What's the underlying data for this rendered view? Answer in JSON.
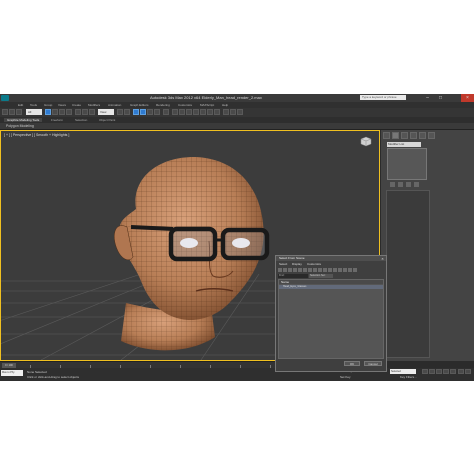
{
  "window": {
    "title": "Autodesk 3ds Max 2012 x64    Elderly_Man_head_render_2.max",
    "search_placeholder": "Type a keyword or phrase"
  },
  "menu": [
    "Edit",
    "Tools",
    "Group",
    "Views",
    "Create",
    "Modifiers",
    "Animation",
    "Graph Editors",
    "Rendering",
    "Customize",
    "MAXScript",
    "Help"
  ],
  "toolbar": {
    "selection_filter": "All",
    "view_dropdown": "View"
  },
  "ribbon": {
    "tabs": [
      "Graphite Modeling Tools",
      "Freeform",
      "Selection",
      "Object Paint"
    ],
    "panel_label": "Polygon Modeling"
  },
  "viewport": {
    "label": "[ + ] [ Perspective ] [ Smooth + Highlights ]"
  },
  "command_panel": {
    "modifier_list": "Modifier List"
  },
  "dialog": {
    "title": "Select From Scene",
    "menu": [
      "Select",
      "Display",
      "Customize"
    ],
    "find_placeholder": "Find:",
    "selection_set": "Selection Set:",
    "column_header": "Name",
    "row_label": "Head_Eyes_Glasses",
    "ok_label": "OK",
    "cancel_label": "Cancel"
  },
  "timeline": {
    "frame": "0 / 100"
  },
  "status": {
    "maxscript_label": "Max to Phy",
    "line1": "None Selected",
    "line2": "Click or click-and-drag to select objects",
    "auto_key": "Auto Key",
    "key_mode": "Selected",
    "set_key": "Set Key",
    "key_filters": "Key Filters..."
  },
  "colors": {
    "viewport_border": "#f0c020",
    "close_button": "#c0392b",
    "skin": "#c08a60",
    "wire": "#4a2a14"
  }
}
